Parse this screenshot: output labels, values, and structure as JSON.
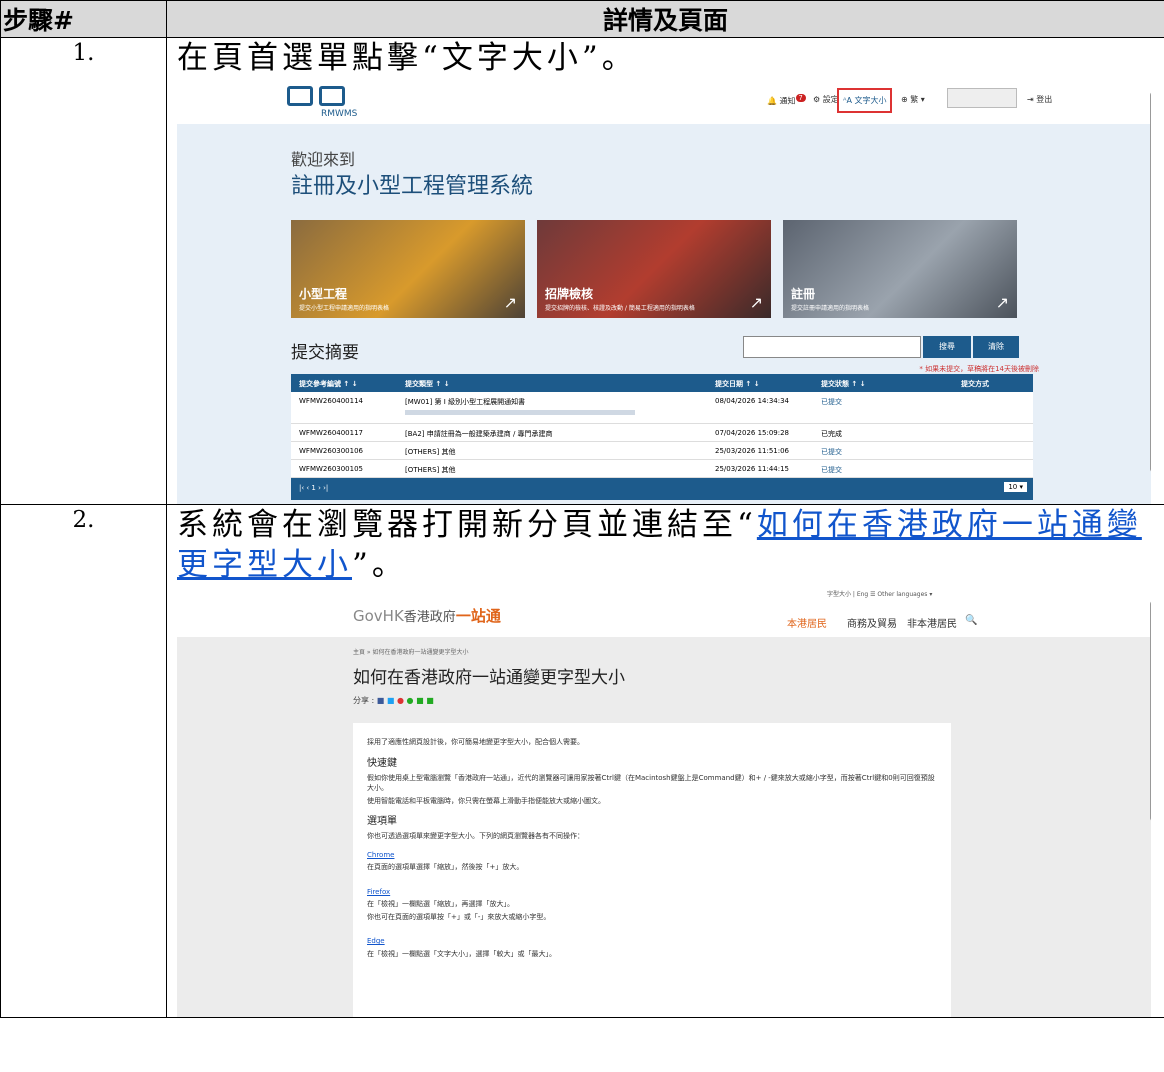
{
  "header": {
    "col1": "步驟#",
    "col2": "詳情及頁面"
  },
  "steps": [
    {
      "no": "1.",
      "text": "在頁首選單點擊“文字大小”。"
    },
    {
      "no": "2.",
      "text_before": "系統會在瀏覽器打開新分頁並連結至“",
      "link": "如何在香港政府一站通變更字型大小",
      "text_after": "”。"
    }
  ],
  "shot1": {
    "logo_sub": "RMWMS",
    "toolbar": {
      "notify": "通知",
      "badge": "7",
      "settings": "設定",
      "font_size": "文字大小",
      "lang": "繁",
      "logout": "登出"
    },
    "welcome": "歡迎來到",
    "system_title": "註冊及小型工程管理系統",
    "cards": [
      {
        "title": "小型工程",
        "sub": "提交小型工程申請適用的指明表格"
      },
      {
        "title": "招牌檢核",
        "sub": "提交招牌的檢核、核證及改動 / 簡易工程適用的指明表格"
      },
      {
        "title": "註冊",
        "sub": "提交註冊申請適用的指明表格"
      }
    ],
    "summary_title": "提交摘要",
    "search_btn": "搜尋",
    "clear_btn": "清除",
    "note": "* 如果未提交，草稿將在14天後被刪除",
    "columns": [
      "提交參考編號 ↑ ↓",
      "提交類型 ↑ ↓",
      "提交日期 ↑ ↓",
      "提交狀態 ↑ ↓",
      "提交方式"
    ],
    "rows": [
      {
        "ref": "WFMW260400114",
        "type": "[MW01] 第 I 級別小型工程展開通知書",
        "date": "08/04/2026 14:34:34",
        "status": "已提交"
      },
      {
        "ref": "WFMW260400117",
        "type": "[BA2] 申請註冊為一般建築承建商 / 專門承建商",
        "date": "07/04/2026 15:09:28",
        "status": "已完成"
      },
      {
        "ref": "WFMW260300106",
        "type": "[OTHERS] 其他",
        "date": "25/03/2026 11:51:06",
        "status": "已提交"
      },
      {
        "ref": "WFMW260300105",
        "type": "[OTHERS] 其他",
        "date": "25/03/2026 11:44:15",
        "status": "已提交"
      }
    ],
    "pager": "|‹  ‹  1  ›  ›|",
    "page_size": "10"
  },
  "shot2": {
    "top_links": "字型大小  |  Eng  ☰ Other languages ▾",
    "logo_a": "GovHK",
    "logo_b": "香港政府",
    "logo_c": "一站通",
    "nav": [
      "本港居民",
      "商務及貿易",
      "非本港居民"
    ],
    "breadcrumb": "主頁 » 如何在香港政府一站通變更字型大小",
    "title": "如何在香港政府一站通變更字型大小",
    "share": "分享 :",
    "intro": "採用了適應性網頁設計後，你可簡易地變更字型大小，配合個人需要。",
    "h_shortcut": "快速鍵",
    "p_shortcut": "假如你使用桌上型電腦瀏覽「香港政府一站通」，近代的瀏覽器可讓用家按著Ctrl鍵（在Macintosh鍵盤上是Command鍵）和+ / -鍵來放大或縮小字型，而按著Ctrl鍵和0則可回復預設大小。",
    "p_mobile": "使用智能電話和平板電腦時，你只需在螢幕上滑動手指便能放大或縮小圖文。",
    "h_menu": "選項單",
    "p_menu": "你也可透過選項單來變更字型大小。下列的網頁瀏覽器各有不同操作：",
    "chrome": "Chrome",
    "p_chrome": "在頁面的選項單選擇「縮放」，然後按「+」放大。",
    "firefox": "Firefox",
    "p_firefox": "在「檢視」一欄點選「縮放」，再選擇「放大」。",
    "p_firefox2": "你也可在頁面的選項單按「+」或「-」來放大或縮小字型。",
    "edge": "Edge",
    "p_edge": "在「檢視」一欄點選「文字大小」，選擇「較大」或「最大」。"
  }
}
